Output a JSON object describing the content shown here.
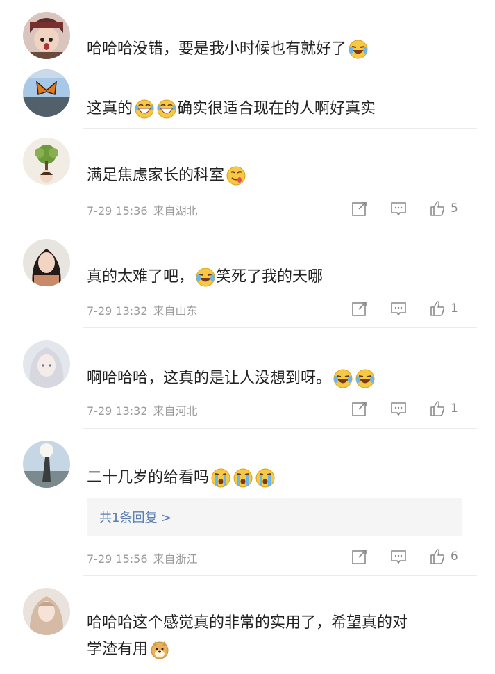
{
  "comments": [
    {
      "text": "哈哈哈没错，要是我小时候也有就好了",
      "emojis": [
        "laugh-cry"
      ],
      "date": "",
      "location": "",
      "likes": ""
    },
    {
      "text_a": "这真的",
      "text_b": "确实很适合现在的人啊好真实",
      "emojis": [
        "grin",
        "grin"
      ],
      "date": "",
      "location": "",
      "likes": ""
    },
    {
      "text": "满足焦虑家长的科室",
      "emojis": [
        "yum"
      ],
      "date": "7-29 15:36",
      "location": "来自湖北",
      "likes": "5"
    },
    {
      "text_a": "真的太难了吧，",
      "text_b": "笑死了我的天哪",
      "emojis": [
        "laugh-cry"
      ],
      "date": "7-29 13:32",
      "location": "来自山东",
      "likes": "1"
    },
    {
      "text": "啊哈哈哈，这真的是让人没想到呀。",
      "emojis": [
        "laugh-cry",
        "laugh-cry"
      ],
      "date": "7-29 13:32",
      "location": "来自河北",
      "likes": "1"
    },
    {
      "text": "二十几岁的给看吗",
      "emojis": [
        "crying",
        "crying",
        "crying"
      ],
      "reply_link": "共1条回复 >",
      "date": "7-29 15:56",
      "location": "来自浙江",
      "likes": "6"
    },
    {
      "text_line1": "哈哈哈这个感觉真的非常的实用了，希望真的对",
      "text_line2": "学渣有用",
      "emojis": [
        "doge"
      ],
      "date": "",
      "location": "",
      "likes": ""
    }
  ],
  "icons": [
    "share-icon",
    "comment-icon",
    "like-icon"
  ],
  "colors": {
    "link": "#5a7eb0",
    "meta": "#9a9a9a",
    "reply_bg": "#f5f5f5"
  }
}
